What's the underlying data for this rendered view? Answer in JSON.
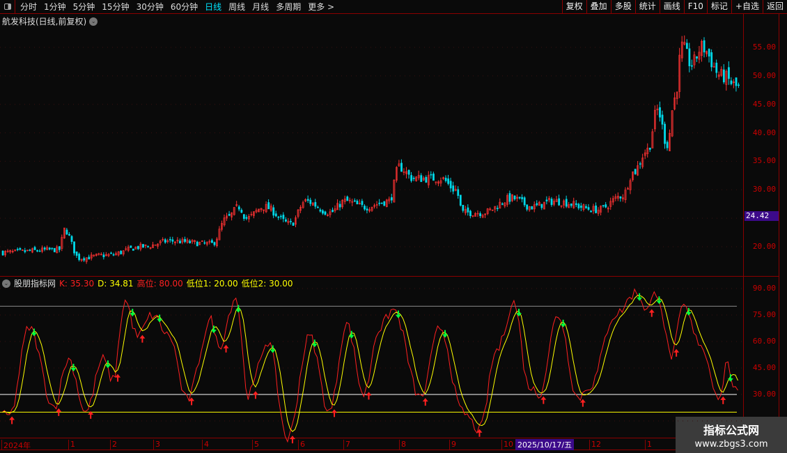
{
  "toolbar": {
    "periods": [
      "分时",
      "1分钟",
      "5分钟",
      "15分钟",
      "30分钟",
      "60分钟",
      "日线",
      "周线",
      "月线",
      "多周期",
      "更多 >"
    ],
    "active": "日线",
    "right_buttons": [
      "复权",
      "叠加",
      "多股",
      "统计",
      "画线",
      "F10",
      "标记",
      "+自选",
      "返回"
    ]
  },
  "chart_title": "航发科技(日线,前复权)",
  "price_axis": {
    "labels": [
      "55.00",
      "50.00",
      "45.00",
      "40.00",
      "35.00",
      "30.00",
      "20.00"
    ],
    "current_price": "24.42"
  },
  "indicator": {
    "name": "股朋指标网",
    "k": "K: 35.30",
    "d": "D: 34.81",
    "high": "高位: 80.00",
    "low1": "低位1: 20.00",
    "low2": "低位2: 30.00",
    "axis_labels": [
      "90.00",
      "75.00",
      "60.00",
      "45.00",
      "30.00"
    ],
    "levels": {
      "high": 80,
      "low1": 20,
      "low2": 30
    }
  },
  "date_axis": {
    "labels": [
      "2024年",
      "1",
      "2",
      "3",
      "4",
      "5",
      "6",
      "7",
      "8",
      "9",
      "10",
      "12",
      "1"
    ],
    "cursor_date": "2025/10/17/五"
  },
  "watermark": {
    "title": "指标公式网",
    "url": "www.zbgs3.com"
  },
  "colors": {
    "up": "#ff3333",
    "down": "#00d8e8",
    "k": "#ff2020",
    "d": "#ffff00",
    "arrow_up": "#ff2020",
    "arrow_down": "#00ff40"
  },
  "chart_data": [
    {
      "type": "candlestick",
      "title": "航发科技 日线",
      "ylim": [
        15,
        58
      ],
      "bars": 300,
      "close_keypoints": [
        [
          0,
          19
        ],
        [
          23,
          19.5
        ],
        [
          25,
          23
        ],
        [
          31,
          18
        ],
        [
          42,
          18.5
        ],
        [
          57,
          20
        ],
        [
          68,
          21
        ],
        [
          85,
          20.5
        ],
        [
          91,
          25
        ],
        [
          96,
          27
        ],
        [
          99,
          25
        ],
        [
          106,
          27
        ],
        [
          117,
          24
        ],
        [
          123,
          28
        ],
        [
          133,
          26
        ],
        [
          139,
          28
        ],
        [
          147,
          27
        ],
        [
          157,
          28
        ],
        [
          161,
          34
        ],
        [
          167,
          32
        ],
        [
          178,
          32
        ],
        [
          184,
          30
        ],
        [
          187,
          26
        ],
        [
          195,
          26
        ],
        [
          207,
          28.5
        ],
        [
          215,
          27
        ],
        [
          224,
          28
        ],
        [
          242,
          26.5
        ],
        [
          252,
          29
        ],
        [
          256,
          33
        ],
        [
          262,
          37
        ],
        [
          266,
          44
        ],
        [
          270,
          38
        ],
        [
          273,
          46
        ],
        [
          276,
          55
        ],
        [
          280,
          52
        ],
        [
          284,
          55
        ],
        [
          292,
          50
        ],
        [
          299,
          48
        ]
      ]
    },
    {
      "type": "line",
      "title": "股朋指标网",
      "ylim": [
        5,
        95
      ],
      "series": [
        {
          "name": "K",
          "keypoints": [
            [
              3,
              18
            ],
            [
              11,
              68
            ],
            [
              21,
              23
            ],
            [
              27,
              50
            ],
            [
              34,
              20
            ],
            [
              41,
              50
            ],
            [
              45,
              38
            ],
            [
              50,
              83
            ],
            [
              55,
              63
            ],
            [
              61,
              75
            ],
            [
              68,
              63
            ],
            [
              75,
              27
            ],
            [
              85,
              72
            ],
            [
              88,
              57
            ],
            [
              95,
              85
            ],
            [
              100,
              30
            ],
            [
              108,
              60
            ],
            [
              116,
              5
            ],
            [
              125,
              63
            ],
            [
              133,
              20
            ],
            [
              140,
              70
            ],
            [
              147,
              30
            ],
            [
              153,
              67
            ],
            [
              159,
              78
            ],
            [
              170,
              28
            ],
            [
              178,
              68
            ],
            [
              187,
              20
            ],
            [
              194,
              10
            ],
            [
              201,
              55
            ],
            [
              208,
              82
            ],
            [
              214,
              35
            ],
            [
              218,
              30
            ],
            [
              226,
              75
            ],
            [
              234,
              28
            ],
            [
              239,
              35
            ],
            [
              249,
              75
            ],
            [
              258,
              88
            ],
            [
              262,
              78
            ],
            [
              266,
              88
            ],
            [
              272,
              52
            ],
            [
              277,
              80
            ],
            [
              283,
              60
            ],
            [
              292,
              28
            ],
            [
              294,
              48
            ],
            [
              299,
              30
            ]
          ]
        },
        {
          "name": "D",
          "smoothing": 4
        }
      ]
    }
  ]
}
